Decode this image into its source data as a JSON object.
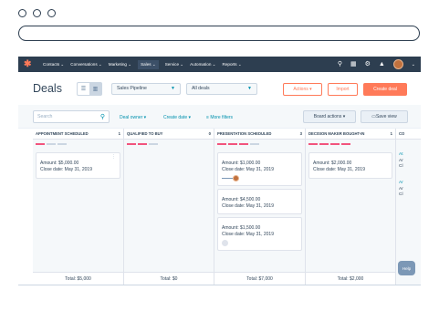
{
  "colors": {
    "nav_bg": "#2d3e50",
    "accent": "#ff7a59",
    "link": "#0091ae",
    "stage_bar": "#f2547d",
    "panel_bg": "#f5f8fa"
  },
  "nav": {
    "logo_icon": "sprocket-icon",
    "items": [
      "Contacts ⌄",
      "Conversations ⌄",
      "Marketing ⌄",
      "Sales ⌄",
      "Service ⌄",
      "Automation ⌄",
      "Reports ⌄"
    ],
    "active_index": 3,
    "icons": [
      "search-icon",
      "marketplace-icon",
      "settings-icon",
      "notifications-icon"
    ]
  },
  "header": {
    "title": "Deals",
    "pipeline": "Sales Pipeline",
    "view": "All deals",
    "actions_label": "Actions ▾",
    "import_label": "Import",
    "create_label": "Create deal"
  },
  "filters": {
    "search_placeholder": "Search",
    "deal_owner": "Deal owner ▾",
    "create_date": "Create date ▾",
    "more_filters": "More filters",
    "board_actions": "Board actions ▾",
    "save_view": "Save view"
  },
  "columns": [
    {
      "title": "APPOINTMENT SCHEDULED",
      "count": "1",
      "cards": [
        {
          "amount": "Amount: $5,000.00",
          "close": "Close date: May 31, 2019"
        }
      ],
      "total": "Total: $5,000"
    },
    {
      "title": "QUALIFIED TO BUY",
      "count": "0",
      "cards": [],
      "total": "Total: $0"
    },
    {
      "title": "PRESENTATION SCHEDULED",
      "count": "3",
      "cards": [
        {
          "amount": "Amount: $1,000.00",
          "close": "Close date: May 31, 2019"
        },
        {
          "amount": "Amount: $4,500.00",
          "close": "Close date: May 31, 2019"
        },
        {
          "amount": "Amount: $1,500.00",
          "close": "Close date: May 31, 2019"
        }
      ],
      "total": "Total: $7,000"
    },
    {
      "title": "DECISION MAKER BOUGHT-IN",
      "count": "1",
      "cards": [
        {
          "amount": "Amount: $2,000.00",
          "close": "Close date: May 31, 2019"
        }
      ],
      "total": "Total: $2,000"
    },
    {
      "title": "CO",
      "lines": [
        "At",
        "Ar",
        "Cl",
        "Ar",
        "Ar",
        "Cl"
      ]
    }
  ],
  "help_label": "Help"
}
